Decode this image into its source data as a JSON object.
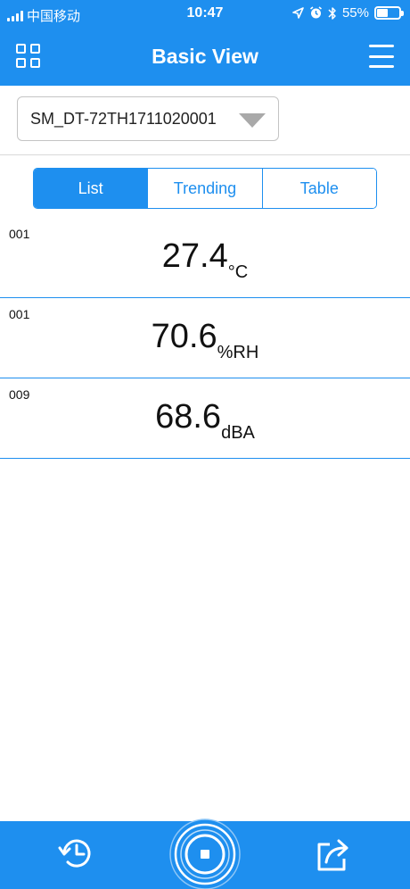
{
  "status_bar": {
    "carrier": "中国移动",
    "time": "10:47",
    "battery": "55%",
    "battery_level": 0.55
  },
  "nav": {
    "title": "Basic View",
    "left_icon": "grid-icon",
    "right_icon": "menu-icon"
  },
  "device": {
    "selected": "SM_DT-72TH1711020001"
  },
  "tabs": [
    {
      "label": "List",
      "active": true
    },
    {
      "label": "Trending",
      "active": false
    },
    {
      "label": "Table",
      "active": false
    }
  ],
  "readings": [
    {
      "channel": "001",
      "value": "27.4",
      "unit": "°C"
    },
    {
      "channel": "001",
      "value": "70.6",
      "unit": "%RH"
    },
    {
      "channel": "009",
      "value": "68.6",
      "unit": "dBA"
    }
  ],
  "toolbar": {
    "history_icon": "history-icon",
    "record_icon": "record-stop-icon",
    "share_icon": "share-icon"
  },
  "colors": {
    "accent": "#1e8fef",
    "divider": "#1e8fef"
  }
}
